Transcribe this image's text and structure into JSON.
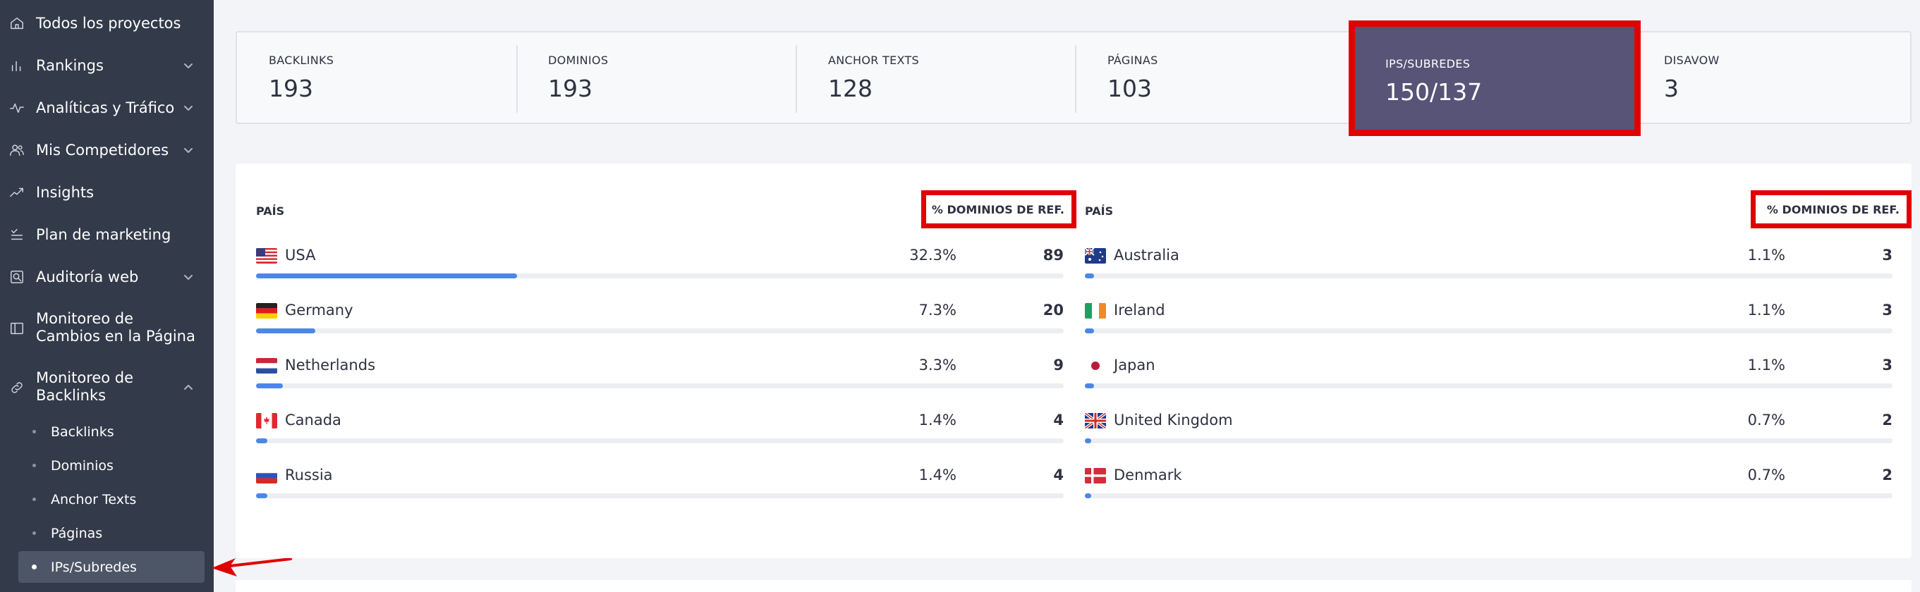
{
  "sidebar": {
    "items": [
      {
        "label": "Todos los proyectos",
        "icon": "home-icon",
        "has_chevron": false
      },
      {
        "label": "Rankings",
        "icon": "bar-chart-icon",
        "has_chevron": true
      },
      {
        "label": "Analíticas y Tráfico",
        "icon": "activity-icon",
        "has_chevron": true
      },
      {
        "label": "Mis Competidores",
        "icon": "users-icon",
        "has_chevron": true
      },
      {
        "label": "Insights",
        "icon": "trend-icon",
        "has_chevron": false
      },
      {
        "label": "Plan de marketing",
        "icon": "checklist-icon",
        "has_chevron": false
      },
      {
        "label": "Auditoría web",
        "icon": "audit-icon",
        "has_chevron": true
      },
      {
        "label": "Monitoreo de Cambios en la Página",
        "icon": "book-icon",
        "has_chevron": false
      },
      {
        "label": "Monitoreo de Backlinks",
        "icon": "link-icon",
        "has_chevron": true,
        "expanded": true
      }
    ],
    "subitems": [
      {
        "label": "Backlinks",
        "active": false
      },
      {
        "label": "Dominios",
        "active": false
      },
      {
        "label": "Anchor Texts",
        "active": false
      },
      {
        "label": "Páginas",
        "active": false
      },
      {
        "label": "IPs/Subredes",
        "active": true
      }
    ]
  },
  "stats": [
    {
      "label": "BACKLINKS",
      "value": "193"
    },
    {
      "label": "DOMINIOS",
      "value": "193"
    },
    {
      "label": "ANCHOR TEXTS",
      "value": "128"
    },
    {
      "label": "PÁGINAS",
      "value": "103"
    },
    {
      "label": "IPS/SUBREDES",
      "value": "150/137",
      "highlighted": true
    },
    {
      "label": "DISAVOW",
      "value": "3"
    }
  ],
  "countries": {
    "header_country": "PAÍS",
    "header_right": "%  DOMINIOS DE REF.",
    "left": [
      {
        "name": "USA",
        "flag": "us-flag-icon",
        "pct": "32.3%",
        "count": "89",
        "share": 0.323
      },
      {
        "name": "Germany",
        "flag": "de-flag-icon",
        "pct": "7.3%",
        "count": "20",
        "share": 0.073
      },
      {
        "name": "Netherlands",
        "flag": "nl-flag-icon",
        "pct": "3.3%",
        "count": "9",
        "share": 0.033
      },
      {
        "name": "Canada",
        "flag": "ca-flag-icon",
        "pct": "1.4%",
        "count": "4",
        "share": 0.014
      },
      {
        "name": "Russia",
        "flag": "ru-flag-icon",
        "pct": "1.4%",
        "count": "4",
        "share": 0.014
      }
    ],
    "right": [
      {
        "name": "Australia",
        "flag": "au-flag-icon",
        "pct": "1.1%",
        "count": "3",
        "share": 0.011
      },
      {
        "name": "Ireland",
        "flag": "ie-flag-icon",
        "pct": "1.1%",
        "count": "3",
        "share": 0.011
      },
      {
        "name": "Japan",
        "flag": "jp-flag-icon",
        "pct": "1.1%",
        "count": "3",
        "share": 0.011
      },
      {
        "name": "United Kingdom",
        "flag": "gb-flag-icon",
        "pct": "0.7%",
        "count": "2",
        "share": 0.007
      },
      {
        "name": "Denmark",
        "flag": "dk-flag-icon",
        "pct": "0.7%",
        "count": "2",
        "share": 0.007
      }
    ]
  },
  "colors": {
    "sidebar_bg": "#333b4a",
    "highlight_border": "#e00000",
    "highlight_fill": "#575478",
    "bar_fill": "#4b87e8"
  }
}
